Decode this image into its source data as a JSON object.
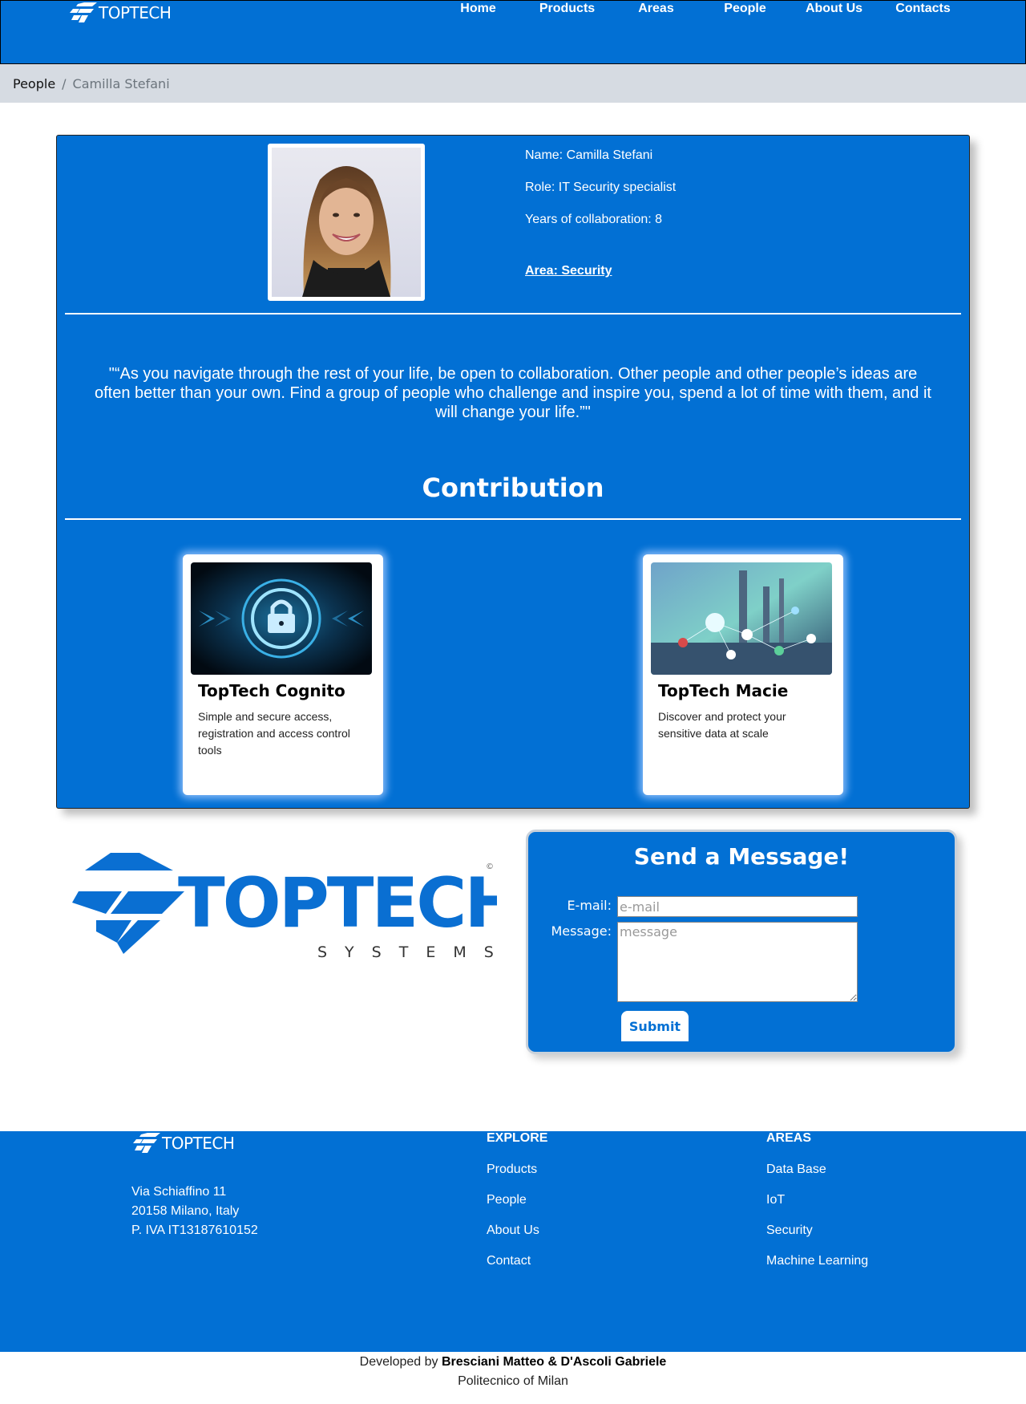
{
  "header": {
    "brand": "TOPTECH",
    "nav": [
      "Home",
      "Products",
      "Areas",
      "People",
      "About Us",
      "Contacts"
    ]
  },
  "breadcrumb": {
    "parent": "People",
    "separator": "/",
    "current": "Camilla Stefani"
  },
  "profile": {
    "name": "Name: Camilla Stefani",
    "role": "Role: IT Security specialist",
    "years": "Years of collaboration: 8",
    "area": "Area: Security",
    "quote": "\"“As you navigate through the rest of your life, be open to collaboration. Other people and other people’s ideas are often better than your own. Find a group of people who challenge and inspire you, spend a lot of time with them, and it will change your life.”\"",
    "contribution_title": "Contribution"
  },
  "products": [
    {
      "title": "TopTech Cognito",
      "description": "Simple and secure access, registration and access control tools"
    },
    {
      "title": "TopTech Macie",
      "description": "Discover and protect your sensitive data at scale"
    }
  ],
  "logo": {
    "word": "TOPTECH",
    "tagline": "SYSTEMS",
    "mark": "©"
  },
  "message_form": {
    "title": "Send a Message!",
    "email_label": "E-mail:",
    "email_placeholder": "e-mail",
    "message_label": "Message:",
    "message_placeholder": "message",
    "submit": "Submit"
  },
  "footer": {
    "brand": "TOPTECH",
    "address": [
      "Via Schiaffino 11",
      "20158 Milano, Italy",
      "P. IVA IT13187610152"
    ],
    "explore_title": "EXPLORE",
    "explore_links": [
      "Products",
      "People",
      "About Us",
      "Contact"
    ],
    "areas_title": "AREAS",
    "areas_links": [
      "Data Base",
      "IoT",
      "Security",
      "Machine Learning"
    ],
    "credits_prefix": "Developed by",
    "credits_names": "Bresciani Matteo & D'Ascoli Gabriele",
    "credits_org": "Politecnico of Milan"
  },
  "colors": {
    "primary": "#0270d4",
    "breadcrumb_bg": "#d6dbe2"
  },
  "icons": [
    "toptech-logo-icon"
  ]
}
